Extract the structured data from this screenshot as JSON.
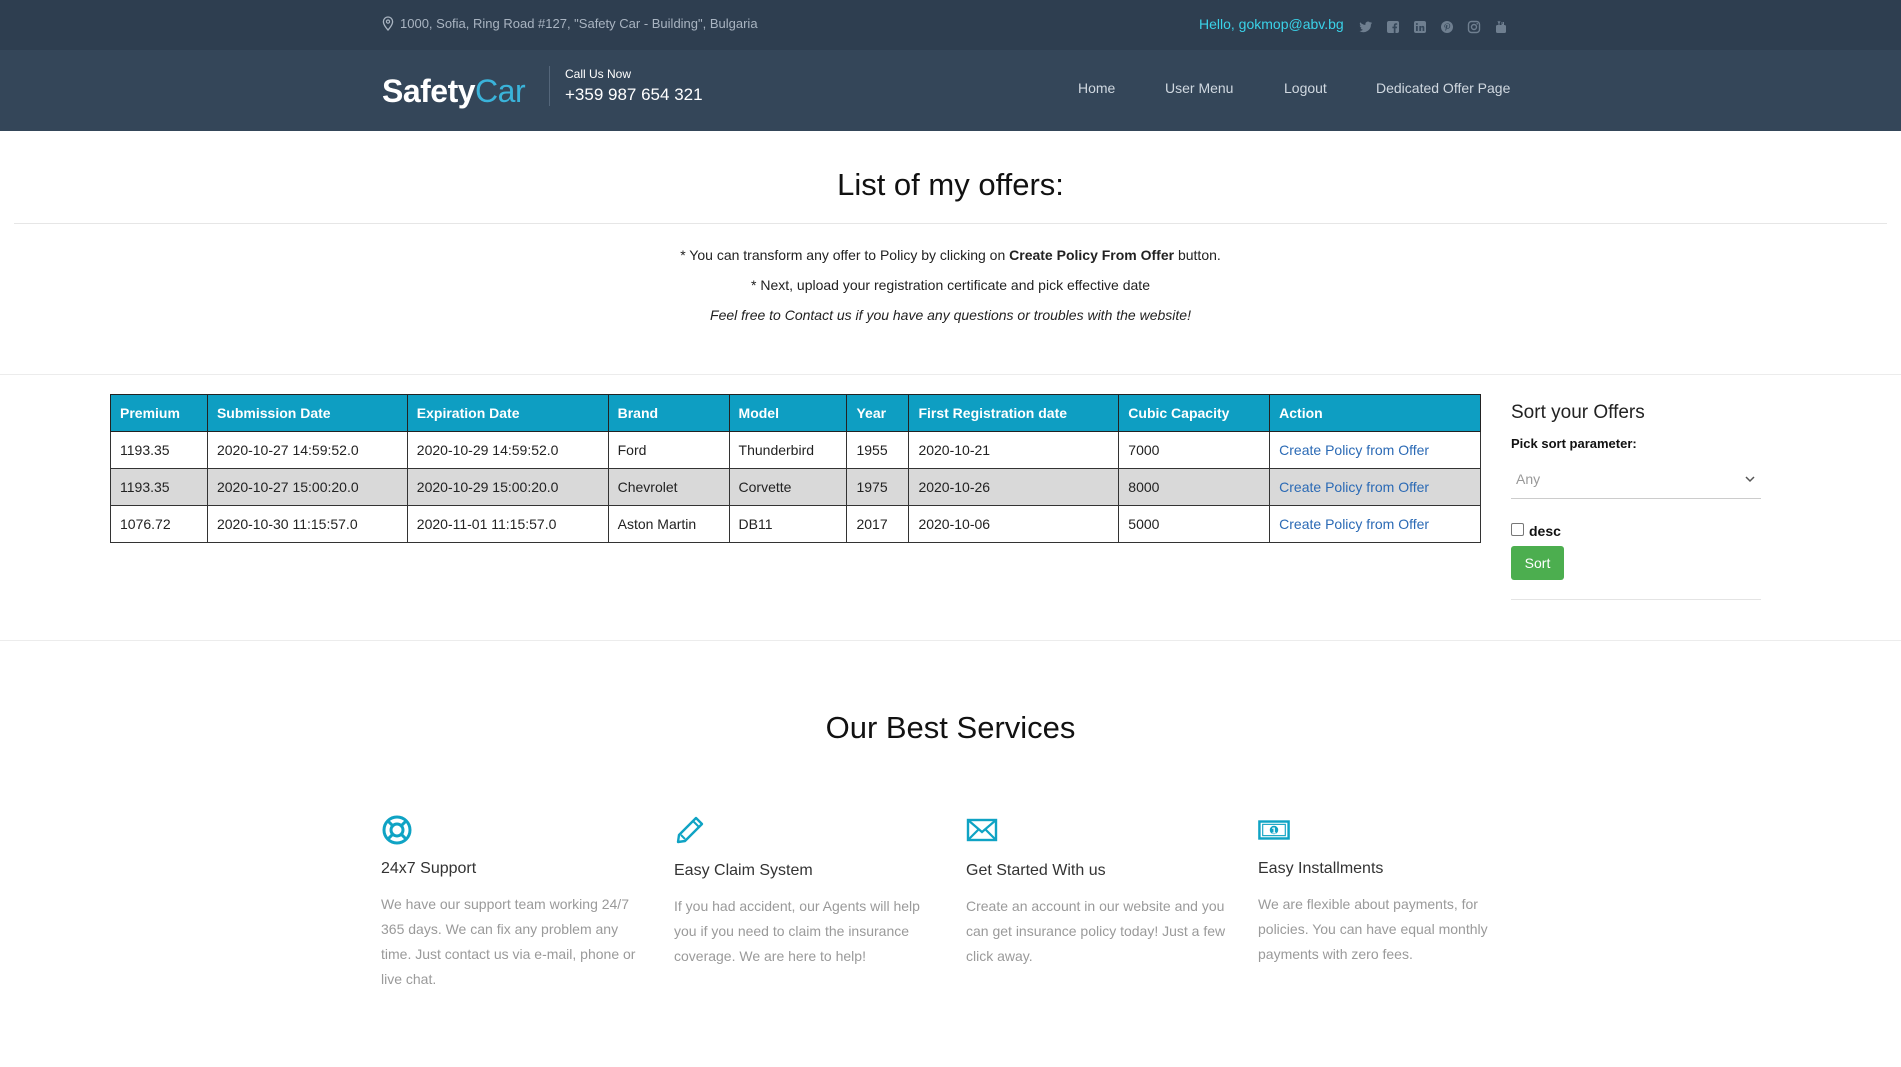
{
  "header": {
    "address": "1000, Sofia, Ring Road #127, \"Safety Car - Building\", Bulgaria",
    "greeting": "Hello, gokmop@abv.bg",
    "logo_main": "Safety",
    "logo_accent": "Car",
    "call_label": "Call Us Now",
    "call_phone": "+359 987 654 321",
    "nav": [
      "Home",
      "User Menu",
      "Logout",
      "Dedicated Offer Page"
    ],
    "socials": [
      "twitter-icon",
      "facebook-icon",
      "linkedin-icon",
      "pinterest-icon",
      "instagram-icon",
      "youtube-icon"
    ]
  },
  "main": {
    "title": "List of my offers:",
    "info_line1_prefix": "* You can transform any offer to Policy by clicking on ",
    "info_line1_bold": "Create Policy From Offer",
    "info_line1_suffix": " button.",
    "info_line2": "* Next, upload your registration certificate and pick effective date",
    "info_line3": "Feel free to Contact us if you have any questions or troubles with the website!"
  },
  "table": {
    "headers": [
      "Premium",
      "Submission Date",
      "Expiration Date",
      "Brand",
      "Model",
      "Year",
      "First Registration date",
      "Cubic Capacity",
      "Action"
    ],
    "rows": [
      [
        "1193.35",
        "2020-10-27 14:59:52.0",
        "2020-10-29 14:59:52.0",
        "Ford",
        "Thunderbird",
        "1955",
        "2020-10-21",
        "7000",
        "Create Policy from Offer"
      ],
      [
        "1193.35",
        "2020-10-27 15:00:20.0",
        "2020-10-29 15:00:20.0",
        "Chevrolet",
        "Corvette",
        "1975",
        "2020-10-26",
        "8000",
        "Create Policy from Offer"
      ],
      [
        "1076.72",
        "2020-10-30 11:15:57.0",
        "2020-11-01 11:15:57.0",
        "Aston Martin",
        "DB11",
        "2017",
        "2020-10-06",
        "5000",
        "Create Policy from Offer"
      ]
    ]
  },
  "sort": {
    "title": "Sort your Offers",
    "label": "Pick sort parameter:",
    "selected": "Any",
    "desc_label": "desc",
    "desc_checked": false,
    "button": "Sort"
  },
  "services": {
    "title": "Our Best Services",
    "items": [
      {
        "icon": "lifebuoy-icon",
        "title": "24x7 Support",
        "text": "We have our support team working 24/7 365 days. We can fix any problem any time. Just contact us via e-mail, phone or live chat."
      },
      {
        "icon": "pencil-icon",
        "title": "Easy Claim System",
        "text": "If you had accident, our Agents will help you if you need to claim the insurance coverage. We are here to help!"
      },
      {
        "icon": "envelope-icon",
        "title": "Get Started With us",
        "text": "Create an account in our website and you can get insurance policy today! Just a few click away."
      },
      {
        "icon": "money-icon",
        "title": "Easy Installments",
        "text": "We are flexible about payments, for policies. You can have equal monthly payments with zero fees."
      }
    ]
  },
  "colors": {
    "header_bg": "#344659",
    "accent": "#0e9ec2",
    "link": "#2b6ab5",
    "sort_button": "#4cae4f"
  }
}
